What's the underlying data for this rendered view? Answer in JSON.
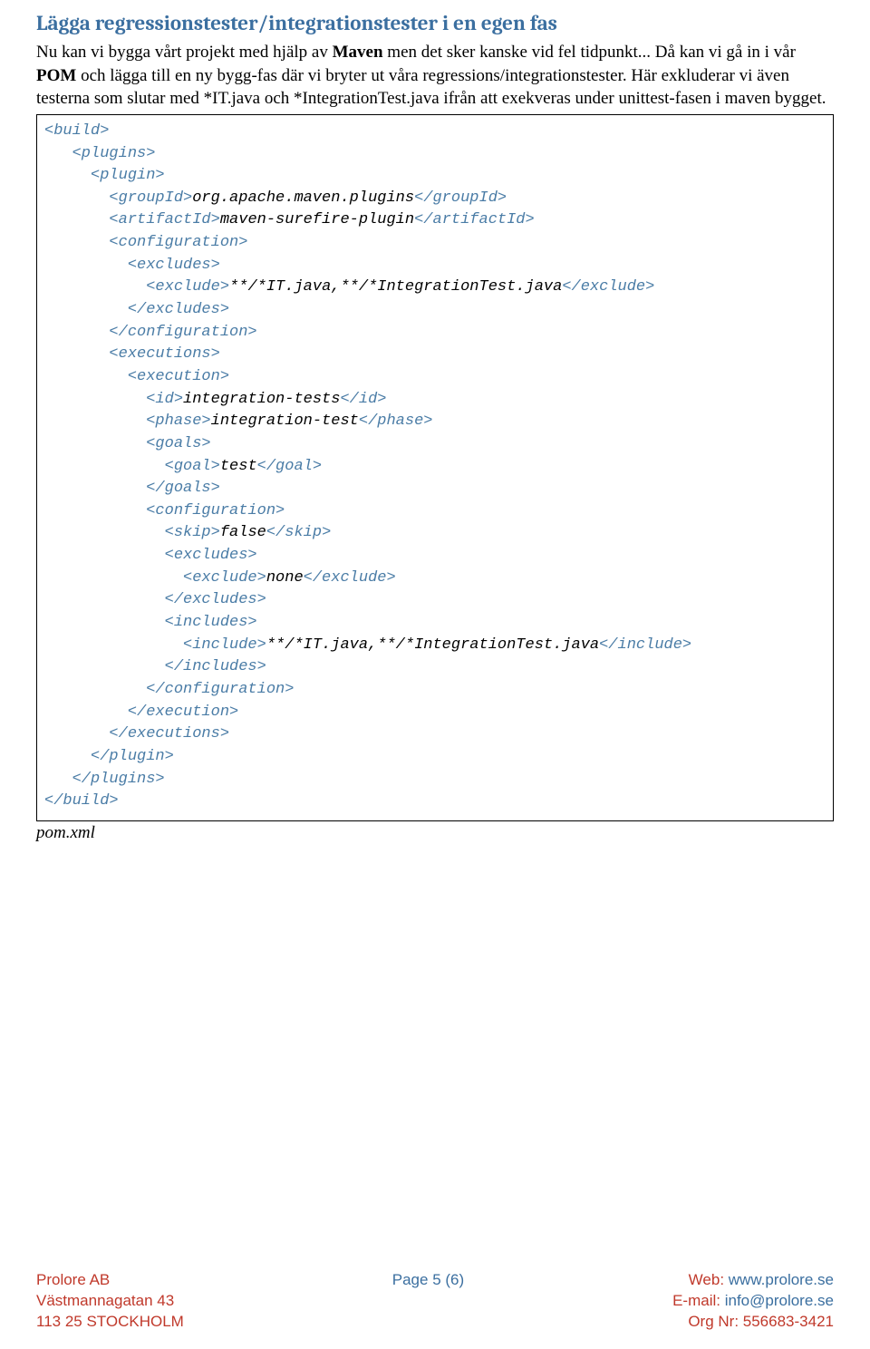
{
  "heading": "Lägga regressionstester/integrationstester i en egen fas",
  "para": {
    "p1a": "Nu kan vi bygga vårt projekt med hjälp av ",
    "p1b": "Maven",
    "p1c": " men det sker kanske vid fel tidpunkt... Då kan vi gå in i vår ",
    "p1d": "POM",
    "p1e": " och lägga till en ny bygg-fas där vi bryter ut våra regressions/integrationstester. Här exkluderar vi även testerna som slutar med *IT.java  och *IntegrationTest.java ifrån att exekveras under unittest-fasen i maven bygget."
  },
  "code": {
    "l01a": "<build>",
    "l02a": "   <plugins>",
    "l03a": "     <plugin>",
    "l04a": "       <groupId>",
    "l04b": "org.apache.maven.plugins",
    "l04c": "</groupId>",
    "l05a": "       <artifactId>",
    "l05b": "maven-surefire-plugin",
    "l05c": "</artifactId>",
    "l06a": "       <configuration>",
    "l07a": "         <excludes>",
    "l08a": "           <exclude>",
    "l08b": "**/*IT.java,**/*IntegrationTest.java",
    "l08c": "</exclude>",
    "l09a": "         </excludes>",
    "l10a": "       </configuration>",
    "l11a": "       <executions>",
    "l12a": "         <execution>",
    "l13a": "           <id>",
    "l13b": "integration-tests",
    "l13c": "</id>",
    "l14a": "           <phase>",
    "l14b": "integration-test",
    "l14c": "</phase>",
    "l15a": "           <goals>",
    "l16a": "             <goal>",
    "l16b": "test",
    "l16c": "</goal>",
    "l17a": "           </goals>",
    "l18a": "           <configuration>",
    "l19a": "             <skip>",
    "l19b": "false",
    "l19c": "</skip>",
    "l20a": "             <excludes>",
    "l21a": "               <exclude>",
    "l21b": "none",
    "l21c": "</exclude>",
    "l22a": "             </excludes>",
    "l23a": "             <includes>",
    "l24a": "               <include>",
    "l24b": "**/*IT.java,**/*IntegrationTest.java",
    "l24c": "</include>",
    "l25a": "             </includes>",
    "l26a": "           </configuration>",
    "l27a": "         </execution>",
    "l28a": "       </executions>",
    "l29a": "     </plugin>",
    "l30a": "   </plugins>",
    "l31a": "</build>"
  },
  "caption": "pom.xml",
  "footer": {
    "left": {
      "l1": "Prolore AB",
      "l2": "Västmannagatan 43",
      "l3": "113 25 STOCKHOLM"
    },
    "center": "Page 5 (6)",
    "right": {
      "l1a": "Web: ",
      "l1b": "www.prolore.se",
      "l2a": "E-mail: ",
      "l2b": "info@prolore.se",
      "l3": "Org Nr: 556683-3421"
    }
  }
}
